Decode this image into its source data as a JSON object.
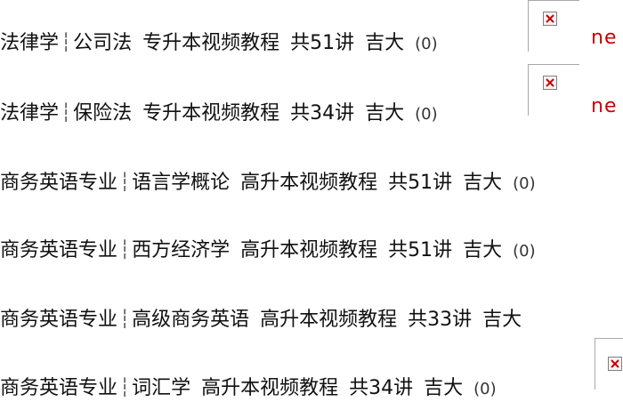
{
  "accent_color": "#cc0000",
  "placeholder_icon": "broken-image-icon",
  "new_tag": "ne",
  "rows": [
    {
      "category": "法律学",
      "title": "公司法",
      "format": "专升本视频教程",
      "lectures": "共51讲",
      "school": "吉大",
      "count": "(0)"
    },
    {
      "category": "法律学",
      "title": "保险法",
      "format": "专升本视频教程",
      "lectures": "共34讲",
      "school": "吉大",
      "count": "(0)"
    },
    {
      "category": "商务英语专业",
      "title": "语言学概论",
      "format": "高升本视频教程",
      "lectures": "共51讲",
      "school": "吉大",
      "count": "(0)"
    },
    {
      "category": "商务英语专业",
      "title": "西方经济学",
      "format": "高升本视频教程",
      "lectures": "共51讲",
      "school": "吉大",
      "count": "(0)"
    },
    {
      "category": "商务英语专业",
      "title": "高级商务英语",
      "format": "高升本视频教程",
      "lectures": "共33讲",
      "school": "吉大",
      "count": ""
    },
    {
      "category": "商务英语专业",
      "title": "词汇学",
      "format": "高升本视频教程",
      "lectures": "共34讲",
      "school": "吉大",
      "count": "(0)"
    }
  ]
}
